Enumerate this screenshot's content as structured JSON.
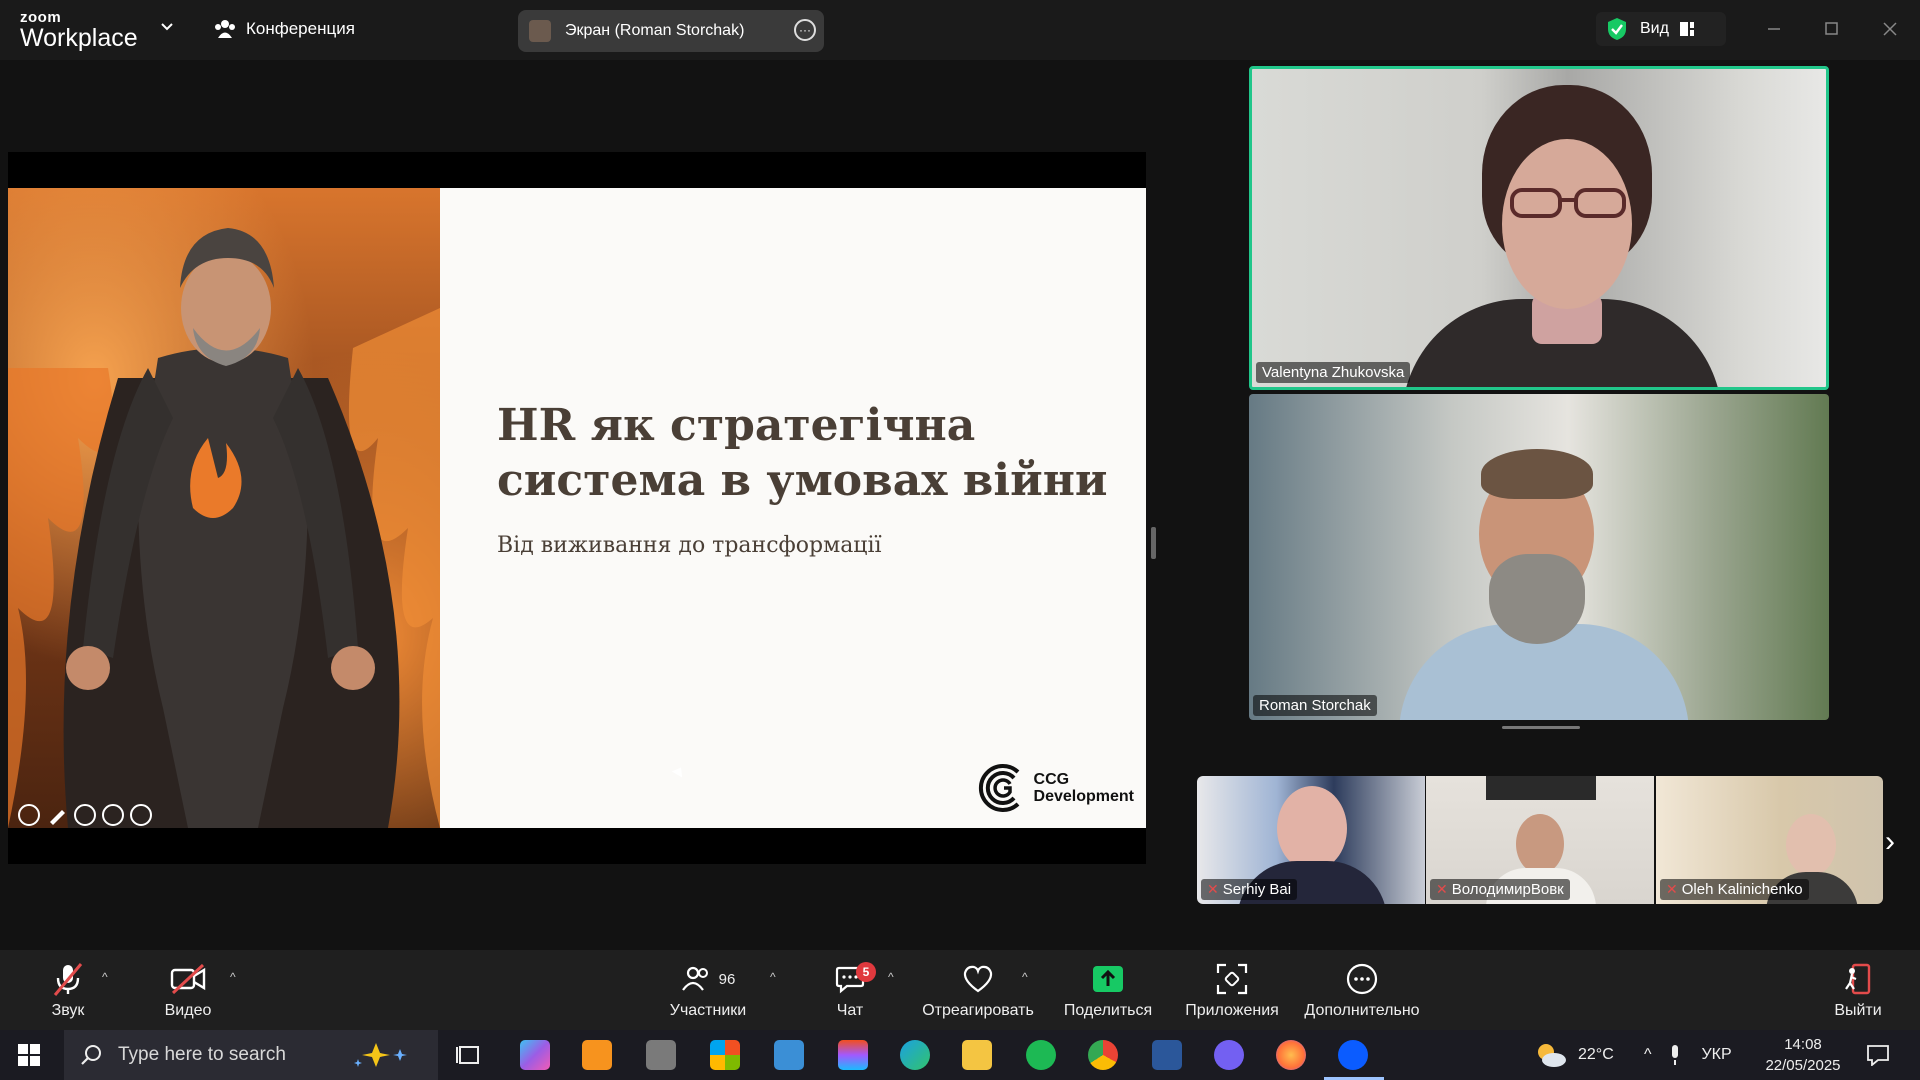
{
  "app": {
    "logo_small": "zoom",
    "logo_big": "Workplace",
    "meeting_label": "Конференция",
    "share_label": "Экран (Roman Storchak)",
    "view_label": "Вид"
  },
  "slide": {
    "title_line1": "HR як стратегічна",
    "title_line2": "система в умовах війни",
    "subtitle": "Від виживання до трансформації",
    "brand_line1": "CCG",
    "brand_line2": "Development"
  },
  "videos": [
    {
      "name": "Valentyna Zhukovska",
      "active": true
    },
    {
      "name": "Roman Storchak",
      "active": false
    }
  ],
  "thumbnails": [
    {
      "name": "Serhiy Bai",
      "muted": true
    },
    {
      "name": "ВолодимирВовк",
      "muted": true
    },
    {
      "name": "Oleh Kalinichenko",
      "muted": true
    }
  ],
  "toolbar": {
    "audio": "Звук",
    "video": "Видео",
    "participants": "Участники",
    "participants_count": "96",
    "chat": "Чат",
    "chat_badge": "5",
    "react": "Отреагировать",
    "share": "Поделиться",
    "apps": "Приложения",
    "more": "Дополнительно",
    "leave": "Выйти"
  },
  "taskbar": {
    "search_placeholder": "Type here to search",
    "temperature": "22°C",
    "language": "УКР",
    "time": "14:08",
    "date": "22/05/2025"
  },
  "colors": {
    "active_speaker": "#21c68a",
    "share_green": "#17c964",
    "muted_red": "#e24b4b",
    "chat_badge": "#e0393e"
  }
}
